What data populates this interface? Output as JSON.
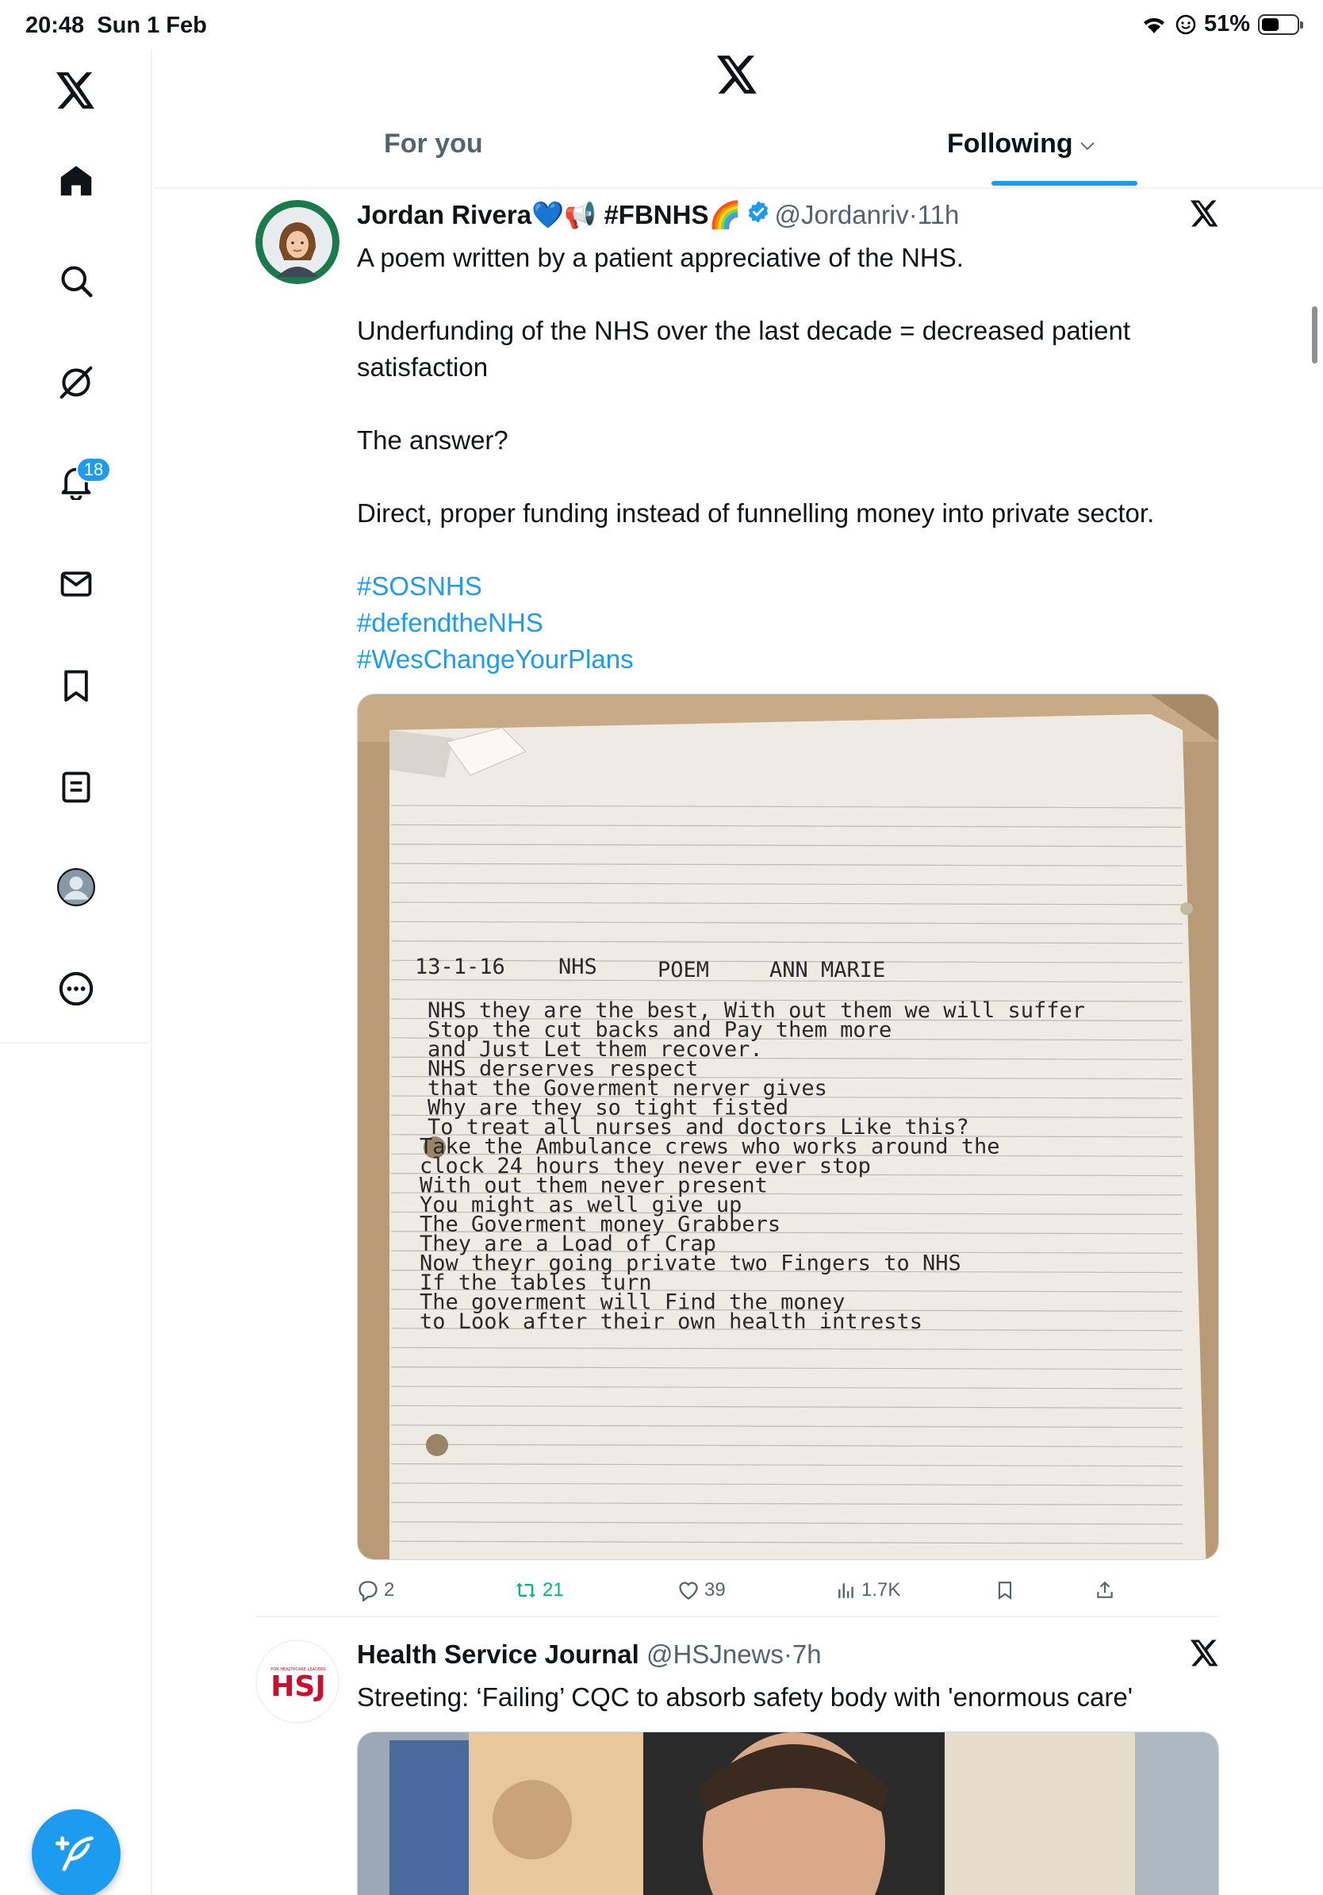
{
  "status": {
    "time": "20:48",
    "date": "Sun 1 Feb",
    "battery": "51%",
    "battery_level": 0.51
  },
  "sidebar": {
    "notifications_badge": "18"
  },
  "header": {
    "tabs": [
      {
        "label": "For you"
      },
      {
        "label": "Following"
      }
    ]
  },
  "tweets": [
    {
      "name": "Jordan Rivera💙📢 #FBNHS🌈",
      "handle": "@Jordanriv",
      "dot": "·",
      "time": "11h",
      "text": "A poem written by a patient appreciative of the NHS.\n\nUnderfunding of the NHS over the last decade = decreased patient satisfaction\n\nThe answer?\n\nDirect, proper funding instead of funnelling money into private sector.",
      "hashtags": [
        "#SOSNHS",
        "#defendtheNHS",
        "#WesChangeYourPlans"
      ],
      "image": {
        "header": [
          "13-1-16",
          "NHS",
          "POEM",
          "ANN MARIE"
        ],
        "lines": [
          "NHS they are the best, With out them we will suffer",
          "Stop the cut backs and Pay them more",
          "and Just Let them recover.",
          "NHS derserves respect",
          "that the Goverment nerver gives",
          "Why are they so tight fisted",
          "To treat all nurses and doctors Like this?",
          "Take the Ambulance crews who works around the",
          "clock 24 hours they never ever stop",
          "With out them never present",
          "You might as well give up",
          "The Goverment money Grabbers",
          "They are a Load of Crap",
          "Now theyr going private two Fingers to NHS",
          "If the tables turn",
          "The goverment will Find the money",
          "to Look after their own health intrests"
        ]
      },
      "stats": {
        "replies": "2",
        "retweets": "21",
        "likes": "39",
        "views": "1.7K"
      }
    },
    {
      "name": "Health Service Journal",
      "handle": "@HSJnews",
      "dot": "·",
      "time": "7h",
      "text": "Streeting: ‘Failing’ CQC to absorb safety body with 'enormous care'",
      "avatar_text": "HSJ",
      "avatar_tagline": "FOR HEALTHCARE LEADERS"
    }
  ],
  "colors": {
    "accent": "#1d9bf0",
    "retweet": "#00ba7c",
    "text": "#0f1419",
    "muted": "#536471"
  }
}
